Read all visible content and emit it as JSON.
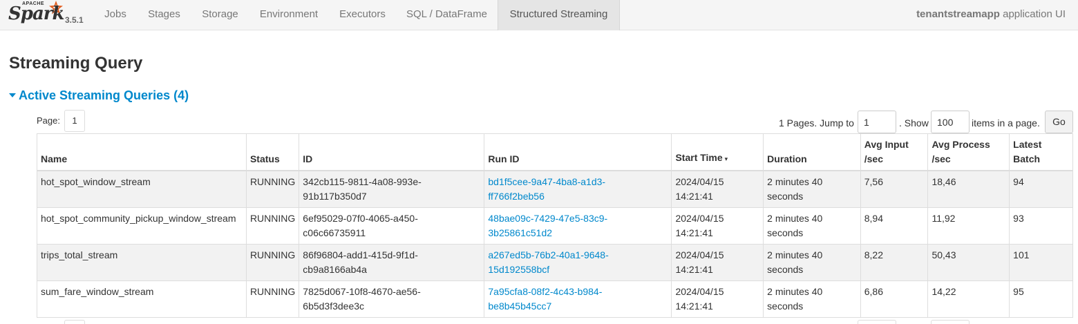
{
  "brand": {
    "apache": "APACHE",
    "logo": "Spark",
    "version": "3.5.1"
  },
  "nav": {
    "tabs": [
      {
        "label": "Jobs"
      },
      {
        "label": "Stages"
      },
      {
        "label": "Storage"
      },
      {
        "label": "Environment"
      },
      {
        "label": "Executors"
      },
      {
        "label": "SQL / DataFrame"
      },
      {
        "label": "Structured Streaming",
        "active": true
      }
    ],
    "app_name": "tenantstreamapp",
    "app_suffix": " application UI"
  },
  "page_title": "Streaming Query",
  "section": {
    "title": "Active Streaming Queries (4)"
  },
  "pagination": {
    "page_label": "Page:",
    "current_page": "1",
    "pages_text": "1 Pages. Jump to",
    "jump_value": "1",
    "show_text": ". Show",
    "page_size": "100",
    "items_text": "items in a page.",
    "go_label": "Go"
  },
  "table": {
    "headers": {
      "name": "Name",
      "status": "Status",
      "id": "ID",
      "run_id": "Run ID",
      "start_time": "Start Time",
      "duration": "Duration",
      "avg_input_1": "Avg Input",
      "avg_input_2": "/sec",
      "avg_process_1": "Avg Process",
      "avg_process_2": "/sec",
      "latest_batch_1": "Latest",
      "latest_batch_2": "Batch",
      "sort_indicator": "▾"
    },
    "rows": [
      {
        "name": "hot_spot_window_stream",
        "status": "RUNNING",
        "id_1": "342cb115-9811-4a08-993e-",
        "id_2": "91b117b350d7",
        "run_id_1": "bd1f5cee-9a47-4ba8-a1d3-",
        "run_id_2": "ff766f2beb56",
        "start_1": "2024/04/15",
        "start_2": "14:21:41",
        "duration_1": "2 minutes 40",
        "duration_2": "seconds",
        "avg_input": "7,56",
        "avg_process": "18,46",
        "latest_batch": "94"
      },
      {
        "name": "hot_spot_community_pickup_window_stream",
        "status": "RUNNING",
        "id_1": "6ef95029-07f0-4065-a450-",
        "id_2": "c06c66735911",
        "run_id_1": "48bae09c-7429-47e5-83c9-",
        "run_id_2": "3b25861c51d2",
        "start_1": "2024/04/15",
        "start_2": "14:21:41",
        "duration_1": "2 minutes 40",
        "duration_2": "seconds",
        "avg_input": "8,94",
        "avg_process": "11,92",
        "latest_batch": "93"
      },
      {
        "name": "trips_total_stream",
        "status": "RUNNING",
        "id_1": "86f96804-add1-415d-9f1d-",
        "id_2": "cb9a8166ab4a",
        "run_id_1": "a267ed5b-76b2-40a1-9648-",
        "run_id_2": "15d192558bcf",
        "start_1": "2024/04/15",
        "start_2": "14:21:41",
        "duration_1": "2 minutes 40",
        "duration_2": "seconds",
        "avg_input": "8,22",
        "avg_process": "50,43",
        "latest_batch": "101"
      },
      {
        "name": "sum_fare_window_stream",
        "status": "RUNNING",
        "id_1": "7825d067-10f8-4670-ae56-",
        "id_2": "6b5d3f3dee3c",
        "run_id_1": "7a95cfa8-08f2-4c43-b984-",
        "run_id_2": "be8b45b45cc7",
        "start_1": "2024/04/15",
        "start_2": "14:21:41",
        "duration_1": "2 minutes 40",
        "duration_2": "seconds",
        "avg_input": "6,86",
        "avg_process": "14,22",
        "latest_batch": "95"
      }
    ]
  }
}
